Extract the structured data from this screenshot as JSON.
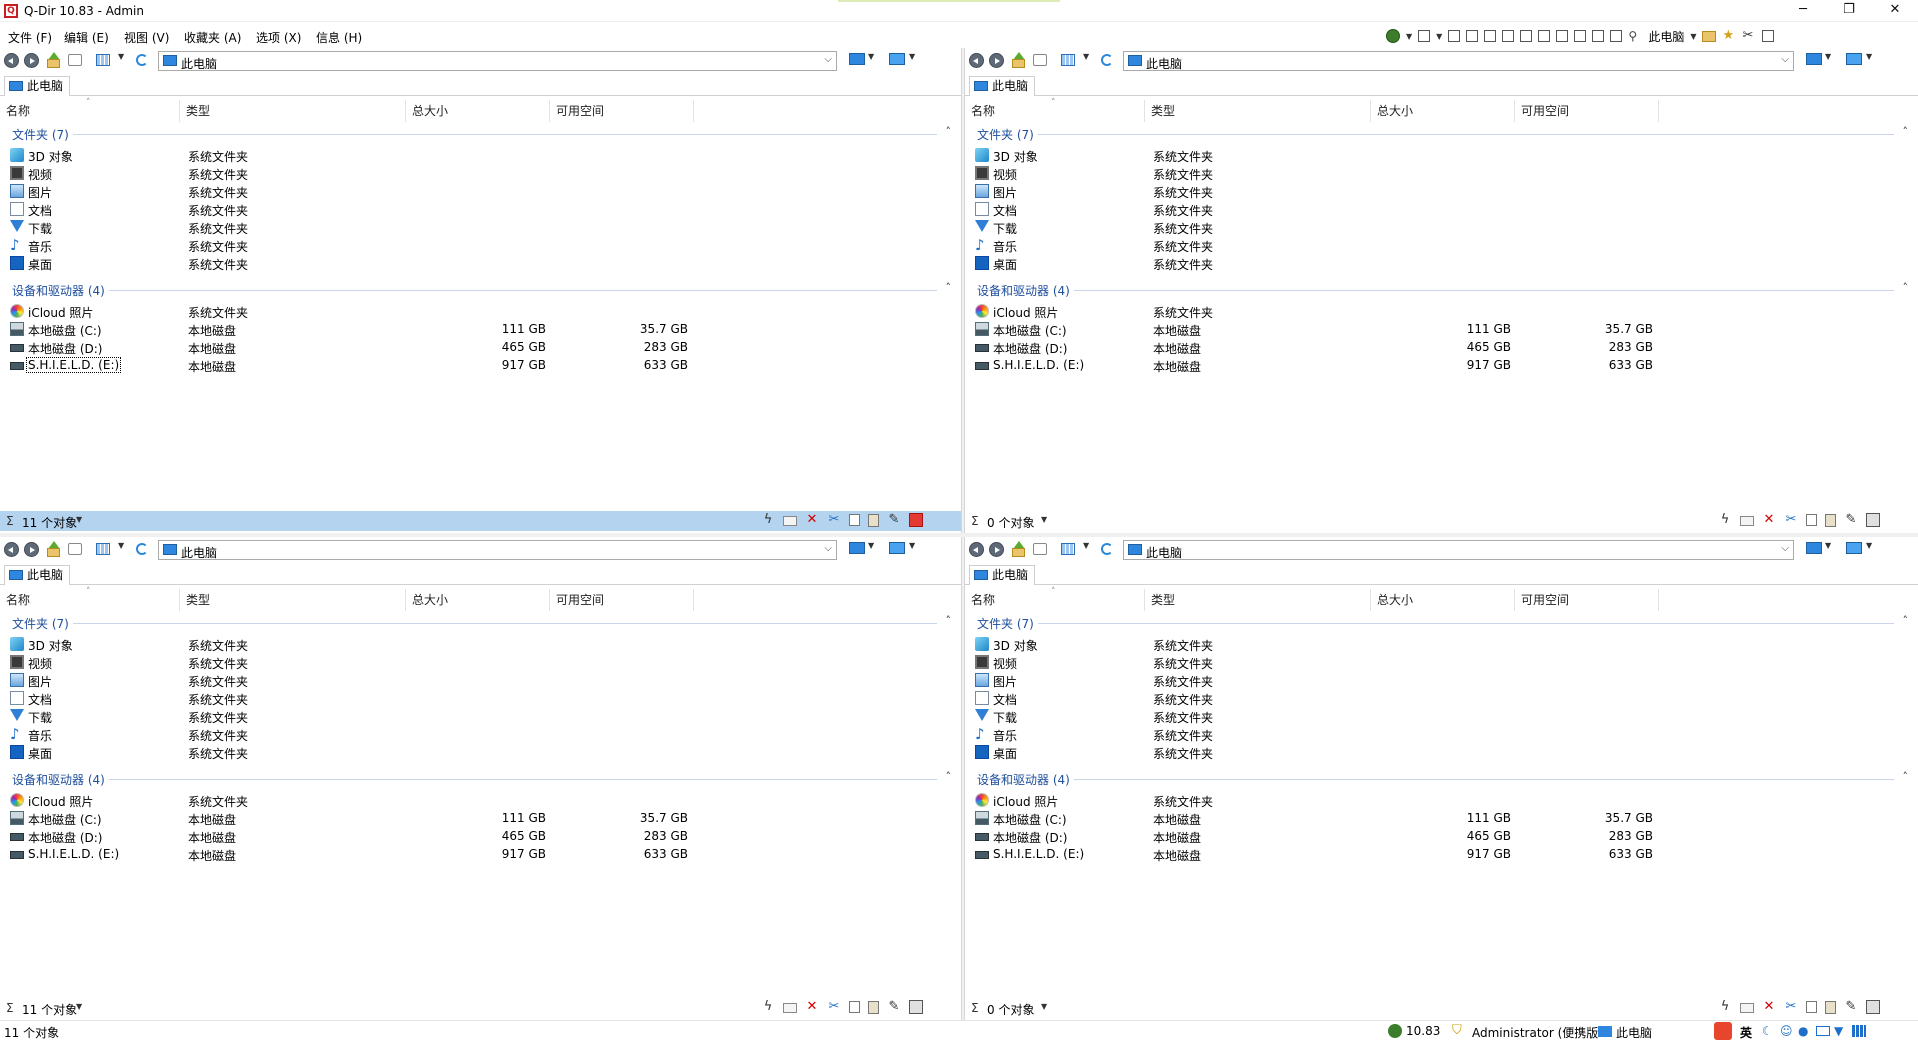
{
  "window": {
    "title": "Q-Dir 10.83 - Admin",
    "app_icon_letter": "Q",
    "minimize": "─",
    "restore": "❐",
    "close": "✕"
  },
  "menu": [
    "文件 (F)",
    "编辑 (E)",
    "视图 (V)",
    "收藏夹 (A)",
    "选项 (X)",
    "信息 (H)"
  ],
  "toolbar_right": {
    "location_label": "此电脑"
  },
  "columns": {
    "name": "名称",
    "type": "类型",
    "total": "总大小",
    "free": "可用空间"
  },
  "address": "此电脑",
  "tab_label": "此电脑",
  "groups": {
    "folders": "文件夹 (7)",
    "devices": "设备和驱动器 (4)"
  },
  "folders": [
    {
      "name": "3D 对象",
      "type": "系统文件夹",
      "icon": "cube-3d-icon"
    },
    {
      "name": "视频",
      "type": "系统文件夹",
      "icon": "video-icon"
    },
    {
      "name": "图片",
      "type": "系统文件夹",
      "icon": "picture-icon"
    },
    {
      "name": "文档",
      "type": "系统文件夹",
      "icon": "document-icon"
    },
    {
      "name": "下载",
      "type": "系统文件夹",
      "icon": "download-icon"
    },
    {
      "name": "音乐",
      "type": "系统文件夹",
      "icon": "music-icon"
    },
    {
      "name": "桌面",
      "type": "系统文件夹",
      "icon": "desktop-icon"
    }
  ],
  "devices": [
    {
      "name": "iCloud 照片",
      "type": "系统文件夹",
      "total": "",
      "free": "",
      "icon": "icloud-photos-icon"
    },
    {
      "name": "本地磁盘 (C:)",
      "type": "本地磁盘",
      "total": "111 GB",
      "free": "35.7 GB",
      "icon": "system-drive-icon"
    },
    {
      "name": "本地磁盘 (D:)",
      "type": "本地磁盘",
      "total": "465 GB",
      "free": "283 GB",
      "icon": "drive-icon"
    },
    {
      "name": "S.H.I.E.L.D. (E:)",
      "type": "本地磁盘",
      "total": "917 GB",
      "free": "633 GB",
      "icon": "drive-icon"
    }
  ],
  "panes": [
    {
      "id": "top-left",
      "count": "11 个对象",
      "active": true
    },
    {
      "id": "top-right",
      "count": "0 个对象",
      "active": false
    },
    {
      "id": "bottom-left",
      "count": "11 个对象",
      "active": false
    },
    {
      "id": "bottom-right",
      "count": "0 个对象",
      "active": false
    }
  ],
  "status": {
    "sigma": "Σ",
    "left_text": "11 个对象",
    "version": "10.83",
    "user": "Administrator (便携版",
    "location": "此电脑",
    "ime": "英"
  },
  "colors": {
    "accent": "#2e86de",
    "active_status": "#b3d3ef",
    "group_text": "#1e4e9c",
    "delete_red": "#d10000"
  }
}
